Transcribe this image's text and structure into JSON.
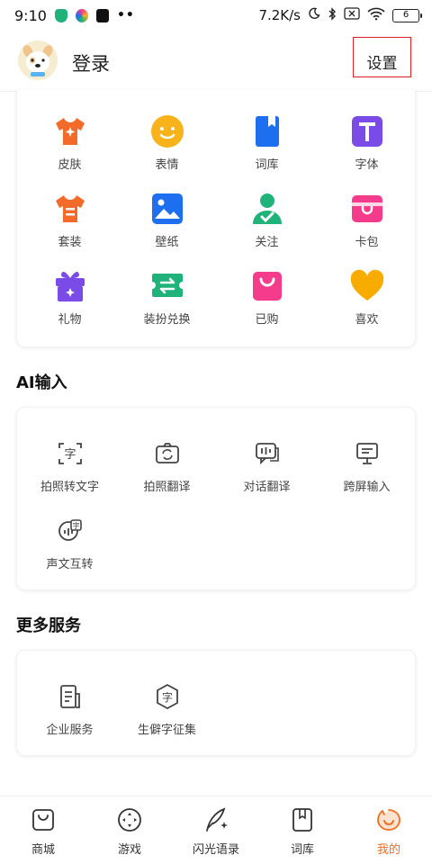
{
  "status_bar": {
    "time": "9:10",
    "dots": "••",
    "speed": "7.2K/s",
    "battery": "6"
  },
  "header": {
    "login": "登录",
    "settings": "设置"
  },
  "top_grid": [
    {
      "label": "皮肤",
      "icon": "shirt-sparkle-icon",
      "color": "#f36b2a"
    },
    {
      "label": "表情",
      "icon": "smiley-face-icon",
      "color": "#f8b21a"
    },
    {
      "label": "词库",
      "icon": "book-icon",
      "color": "#1e6fef"
    },
    {
      "label": "字体",
      "icon": "font-t-icon",
      "color": "#7a4be6"
    },
    {
      "label": "套装",
      "icon": "suit-shirt-icon",
      "color": "#f36b2a"
    },
    {
      "label": "壁纸",
      "icon": "wallpaper-image-icon",
      "color": "#1e6fef"
    },
    {
      "label": "关注",
      "icon": "follow-user-check-icon",
      "color": "#1fb37a"
    },
    {
      "label": "卡包",
      "icon": "card-wallet-icon",
      "color": "#f53c8c"
    },
    {
      "label": "礼物",
      "icon": "gift-icon",
      "color": "#7a4be6"
    },
    {
      "label": "装扮兑换",
      "icon": "exchange-ticket-icon",
      "color": "#1fb37a"
    },
    {
      "label": "已购",
      "icon": "shopping-bag-icon",
      "color": "#f53c8c"
    },
    {
      "label": "喜欢",
      "icon": "heart-icon",
      "color": "#f8ac00"
    }
  ],
  "ai_section": {
    "title": "AI输入",
    "items": [
      {
        "label": "拍照转文字",
        "icon": "photo-to-text-icon"
      },
      {
        "label": "拍照翻译",
        "icon": "photo-translate-icon"
      },
      {
        "label": "对话翻译",
        "icon": "dialog-translate-icon"
      },
      {
        "label": "跨屏输入",
        "icon": "cross-screen-input-icon"
      },
      {
        "label": "声文互转",
        "icon": "voice-text-convert-icon"
      }
    ]
  },
  "more_section": {
    "title": "更多服务",
    "items": [
      {
        "label": "企业服务",
        "icon": "enterprise-doc-icon"
      },
      {
        "label": "生僻字征集",
        "icon": "rare-char-collect-icon"
      }
    ]
  },
  "bottom_nav": [
    {
      "label": "商城",
      "icon": "shop-bag-icon",
      "active": false
    },
    {
      "label": "游戏",
      "icon": "game-controller-icon",
      "active": false
    },
    {
      "label": "闪光语录",
      "icon": "quill-sparkle-icon",
      "active": false
    },
    {
      "label": "词库",
      "icon": "bookmark-book-icon",
      "active": false
    },
    {
      "label": "我的",
      "icon": "profile-mine-icon",
      "active": true
    }
  ],
  "colors": {
    "accent": "#f26c21",
    "highlight_border": "#e02020"
  }
}
